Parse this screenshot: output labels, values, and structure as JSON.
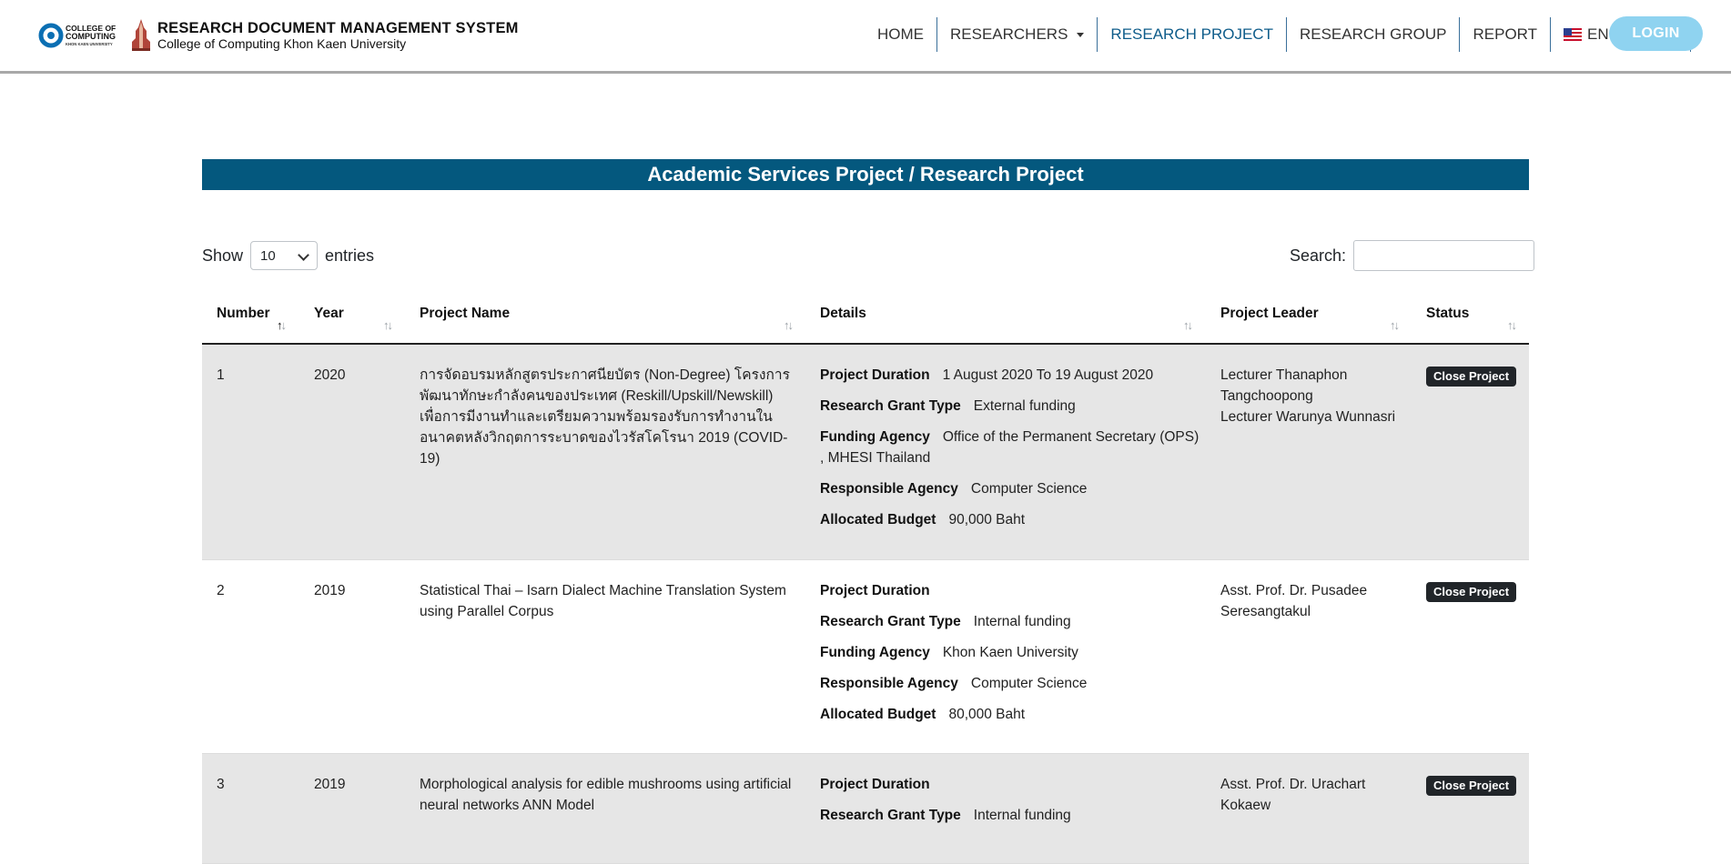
{
  "header": {
    "logo_cc_text": [
      "COLLEGE OF",
      "COMPUTING",
      "KHON KAEN UNIVERSITY"
    ],
    "title": "RESEARCH DOCUMENT MANAGEMENT SYSTEM",
    "subtitle": "College of Computing Khon Kaen University",
    "nav": [
      "HOME",
      "RESEARCHERS",
      "RESEARCH PROJECT",
      "RESEARCH GROUP",
      "REPORT",
      "ENGLISH"
    ],
    "login": "LOGIN"
  },
  "page_title": "Academic Services Project / Research Project",
  "controls": {
    "show_label": "Show",
    "entries_value": "10",
    "entries_label": "entries",
    "search_label": "Search:"
  },
  "table": {
    "columns": [
      "Number",
      "Year",
      "Project Name",
      "Details",
      "Project Leader",
      "Status"
    ],
    "detail_labels": {
      "duration": "Project Duration",
      "grant": "Research Grant Type",
      "agency": "Funding Agency",
      "responsible": "Responsible Agency",
      "budget": "Allocated Budget"
    },
    "rows": [
      {
        "number": "1",
        "year": "2020",
        "name": "การจัดอบรมหลักสูตรประกาศนียบัตร (Non-Degree) โครงการพัฒนาทักษะกำลังคนของประเทศ (Reskill/Upskill/Newskill) เพื่อการมีงานทำและเตรียมความพร้อมรองรับการทำงานในอนาคตหลังวิกฤตการระบาดของไวรัสโคโรนา 2019 (COVID-19)",
        "duration": "1 August 2020 To 19 August 2020",
        "grant": "External funding",
        "agency_line1": "Office of the Permanent Secretary (OPS)",
        "agency_line2": ", MHESI Thailand",
        "responsible": "Computer Science",
        "budget": "90,000 Baht",
        "leader_lines": [
          "Lecturer Thanaphon",
          "Tangchoopong",
          "Lecturer Warunya Wunnasri"
        ],
        "status": "Close Project"
      },
      {
        "number": "2",
        "year": "2019",
        "name": "Statistical Thai – Isarn Dialect Machine Translation System using Parallel Corpus",
        "duration": "",
        "grant": "Internal funding",
        "agency_line1": "Khon Kaen University",
        "agency_line2": "",
        "responsible": "Computer Science",
        "budget": "80,000 Baht",
        "leader_lines": [
          "Asst. Prof. Dr. Pusadee",
          "Seresangtakul"
        ],
        "status": "Close Project"
      },
      {
        "number": "3",
        "year": "2019",
        "name": "Morphological analysis for edible mushrooms using artificial neural networks ANN Model",
        "duration": "",
        "grant": "Internal funding",
        "leader_lines": [
          "Asst. Prof. Dr. Urachart",
          "Kokaew"
        ],
        "status": "Close Project"
      }
    ]
  }
}
